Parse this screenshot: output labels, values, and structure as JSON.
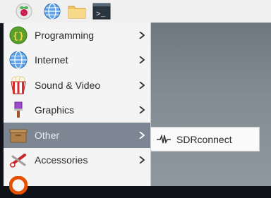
{
  "taskbar": {
    "buttons": [
      {
        "icon": "raspberry-pi-icon"
      },
      {
        "icon": "globe-icon"
      },
      {
        "icon": "folder-icon"
      },
      {
        "icon": "terminal-icon"
      }
    ],
    "terminal_glyph": ">_"
  },
  "menu": {
    "items": [
      {
        "label": "Programming",
        "icon": "programming-icon"
      },
      {
        "label": "Internet",
        "icon": "globe-icon"
      },
      {
        "label": "Sound & Video",
        "icon": "popcorn-icon"
      },
      {
        "label": "Graphics",
        "icon": "paintbrush-icon"
      },
      {
        "label": "Other",
        "icon": "box-icon",
        "highlighted": true
      },
      {
        "label": "Accessories",
        "icon": "scissors-icon"
      }
    ]
  },
  "submenu": {
    "items": [
      {
        "label": "SDRconnect",
        "icon": "waveform-icon"
      }
    ]
  },
  "colors": {
    "highlight": "#7c8793",
    "desktop": "#7a858e"
  }
}
